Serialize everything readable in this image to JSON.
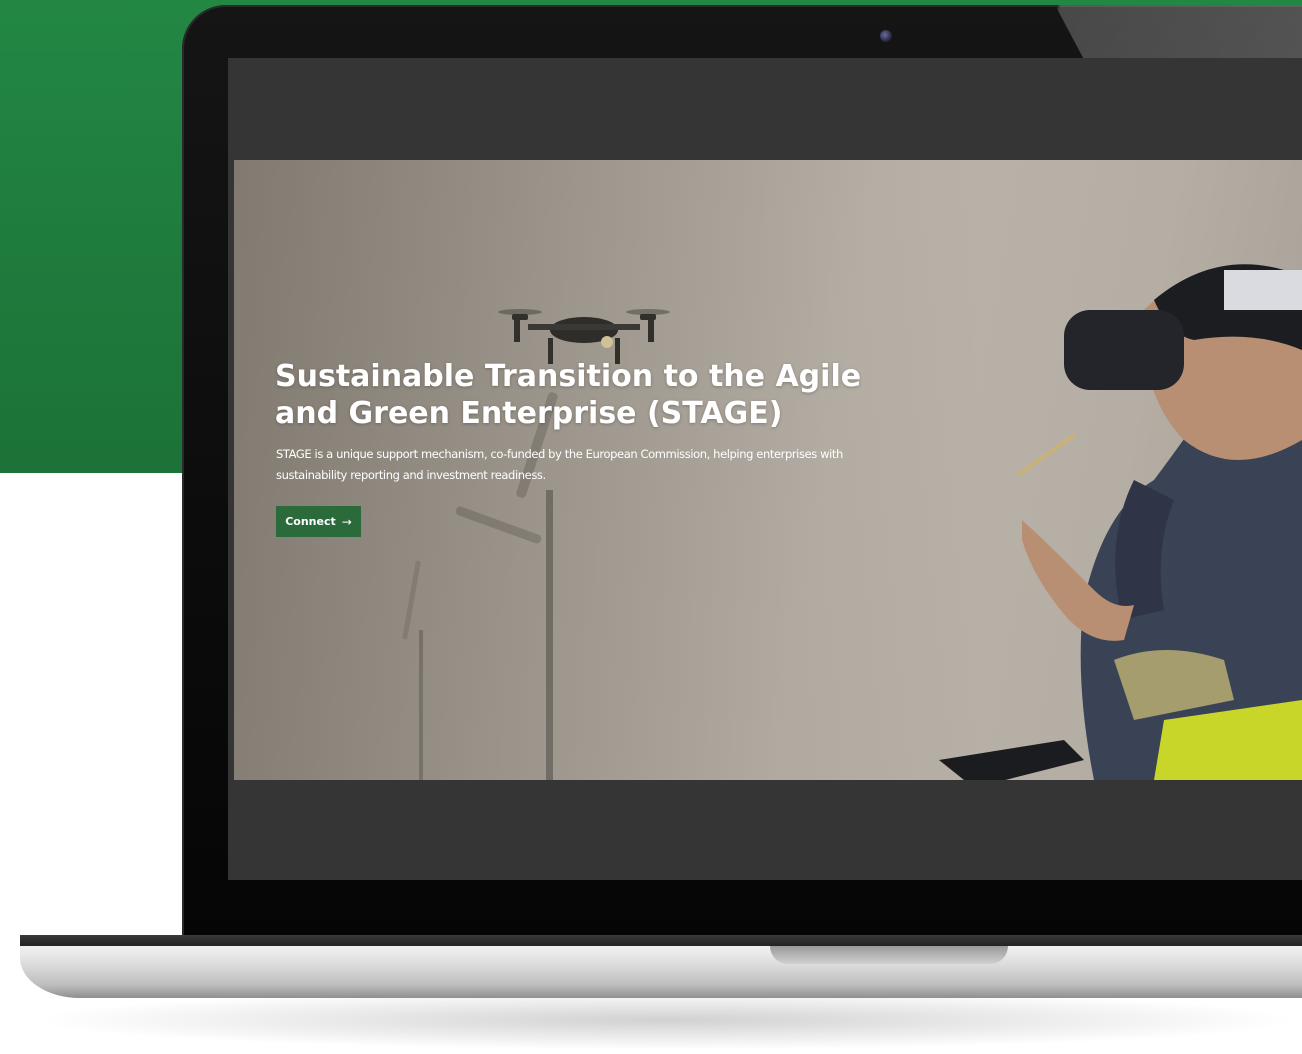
{
  "hero": {
    "title": "Sustainable Transition to the Agile and Green Enterprise (STAGE)",
    "description": "STAGE is a unique support mechanism, co-funded by the European Commission, helping enterprises with sustainability reporting and investment readiness.",
    "cta": {
      "label": "Connect",
      "icon": "arrow-right-icon",
      "arrow_glyph": "→"
    }
  },
  "colors": {
    "brand_green": "#238744",
    "button_green": "#2b6a3b",
    "screen_frame": "#353535"
  }
}
